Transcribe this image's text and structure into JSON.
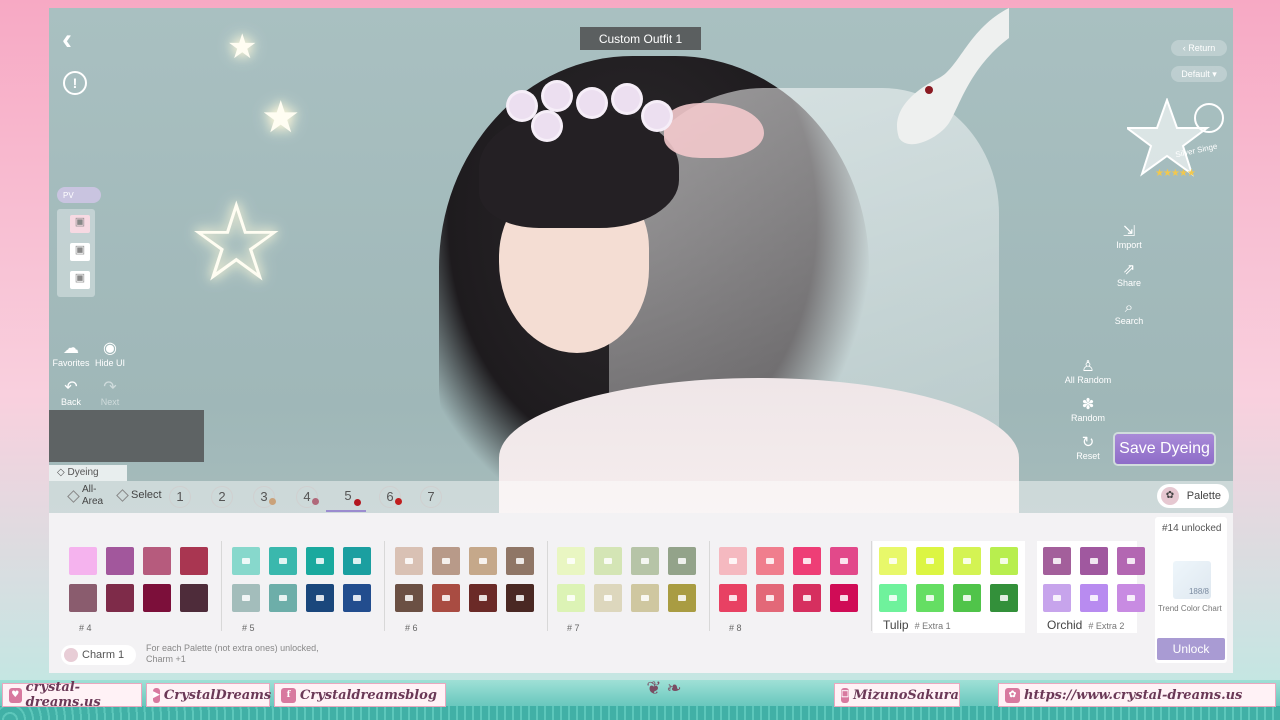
{
  "window": {
    "outfit_title": "Custom Outfit 1",
    "back_icon": "chevron-left-icon",
    "alert_icon": "exclamation-circle-icon"
  },
  "left_panel": {
    "pv_label": "PV",
    "favorites": "Favorites",
    "hide_ui": "Hide UI",
    "back": "Back",
    "next": "Next"
  },
  "right_panel": {
    "return_label": "Return",
    "default_label": "Default",
    "badge_label": "Silver Singe",
    "badge_stars": "★★★★★",
    "import": "Import",
    "share": "Share",
    "search": "Search",
    "all_random": "All Random",
    "random": "Random",
    "reset": "Reset",
    "save_dyeing": "Save Dyeing"
  },
  "dyeing": {
    "tab_label": "Dyeing",
    "all_area": "All-\nArea",
    "select": "Select",
    "number_tabs": [
      {
        "label": "1",
        "dot": ""
      },
      {
        "label": "2",
        "dot": ""
      },
      {
        "label": "3",
        "dot": "#caa27a"
      },
      {
        "label": "4",
        "dot": "#b0687a"
      },
      {
        "label": "5",
        "dot": "#b3171f"
      },
      {
        "label": "6",
        "dot": "#c01e1e"
      },
      {
        "label": "7",
        "dot": ""
      }
    ],
    "selected_tab": "5",
    "palette_button": "Palette"
  },
  "palettes": [
    {
      "label": "# 4",
      "colors": [
        "#f5b3ee",
        "#a2579c",
        "#b65b7d",
        "#a93651",
        "#8a5c6e",
        "#7e2b49",
        "#7c0f3a",
        "#4e2c3a"
      ],
      "locked": false
    },
    {
      "label": "# 5",
      "colors": [
        "#87d8cc",
        "#3ab8ad",
        "#1aa99e",
        "#1b9fa0",
        "#a3bdbb",
        "#6daea9",
        "#1a477c",
        "#224d8e"
      ],
      "locked": true
    },
    {
      "label": "# 6",
      "colors": [
        "#d9c1b4",
        "#b89a89",
        "#c5a88a",
        "#8f7666",
        "#6b5044",
        "#a94c42",
        "#6b2a27",
        "#4a2823"
      ],
      "locked": true
    },
    {
      "label": "# 7",
      "colors": [
        "#e9f6c2",
        "#d4e5b5",
        "#b6c4a7",
        "#93a38a",
        "#dcf3b5",
        "#ddd7bd",
        "#cfc7a0",
        "#a99c42"
      ],
      "locked": true
    },
    {
      "label": "# 8",
      "colors": [
        "#f5b9c0",
        "#f07e8d",
        "#ee3e76",
        "#e2498a",
        "#e84163",
        "#e36878",
        "#d62f5f",
        "#d00c56"
      ],
      "locked": true
    }
  ],
  "extras": [
    {
      "name": "Tulip",
      "tag": "# Extra 1",
      "colors": [
        "#e8f86a",
        "#dcf542",
        "#d4f353",
        "#b8ee4e",
        "#6ff29c",
        "#65de63",
        "#50c44a",
        "#33903a"
      ]
    },
    {
      "name": "Orchid",
      "tag": "# Extra 2",
      "colors": [
        "#a35f9b",
        "#a0589f",
        "#b367b2",
        "#c7a4ec",
        "#b88bf0",
        "#c88be2"
      ]
    }
  ],
  "unlock": {
    "status": "#14 unlocked",
    "progress_text": "188/8",
    "trend_label": "Trend Color Chart",
    "unlock_button": "Unlock"
  },
  "charm": {
    "label": "Charm 1",
    "note": "For each Palette (not extra ones) unlocked, Charm +1"
  },
  "footer": {
    "items": [
      {
        "icon": "heart-icon",
        "glyph": "♥",
        "text": "crystal-dreams.us"
      },
      {
        "icon": "youtube-icon",
        "glyph": "▶",
        "text": "CrystalDreams"
      },
      {
        "icon": "instagram-facebook-icon",
        "glyph": "f",
        "text": "Crystaldreamsblog"
      },
      {
        "icon": "twitch-icon",
        "glyph": "☐",
        "text": "MizunoSakura"
      },
      {
        "icon": "sakura-icon",
        "glyph": "✿",
        "text": "https://www.crystal-dreams.us"
      }
    ]
  }
}
